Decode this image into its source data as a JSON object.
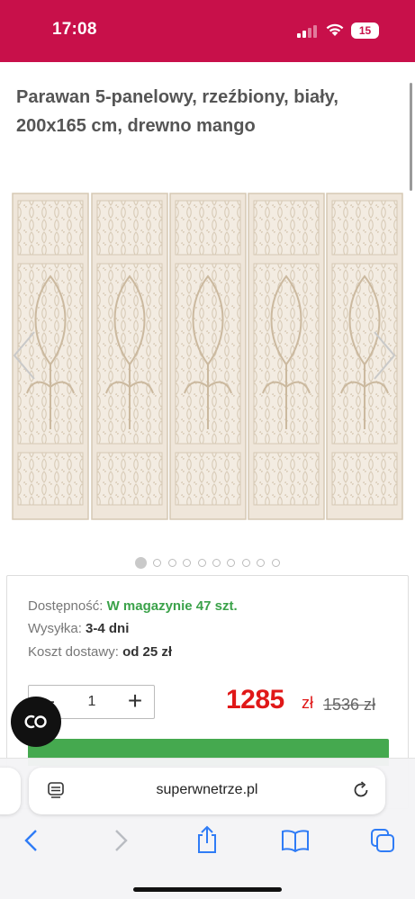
{
  "status_bar": {
    "time": "17:08",
    "battery": "15",
    "background_color": "#c8104a"
  },
  "product": {
    "title": "Parawan 5-panelowy, rzeźbiony, biały, 200x165 cm, drewno mango"
  },
  "gallery": {
    "image_icon": "carved-screen-image",
    "prev_icon": "chevron-left-icon",
    "next_icon": "chevron-right-icon",
    "dot_count": 10,
    "active_index": 0
  },
  "details": {
    "availability_label": "Dostępność:",
    "availability_value": "W magazynie 47 szt.",
    "availability_suffix": ".",
    "shipping_label": "Wysyłka:",
    "shipping_value": "3-4 dni",
    "delivery_label": "Koszt dostawy:",
    "delivery_value": "od 25 zł"
  },
  "purchase": {
    "quantity": "1",
    "minus_label": "−",
    "plus_label": "+",
    "price": "1285",
    "currency": "zł",
    "old_price": "1536 zł",
    "price_color": "#e01818",
    "button_color": "#45a94f"
  },
  "chat": {
    "icon": "chat-co-icon"
  },
  "browser": {
    "url": "superwnetrze.pl",
    "icons": [
      "reader-icon",
      "reload-icon",
      "back-icon",
      "forward-icon",
      "share-icon",
      "bookmarks-icon",
      "tabs-icon"
    ]
  }
}
